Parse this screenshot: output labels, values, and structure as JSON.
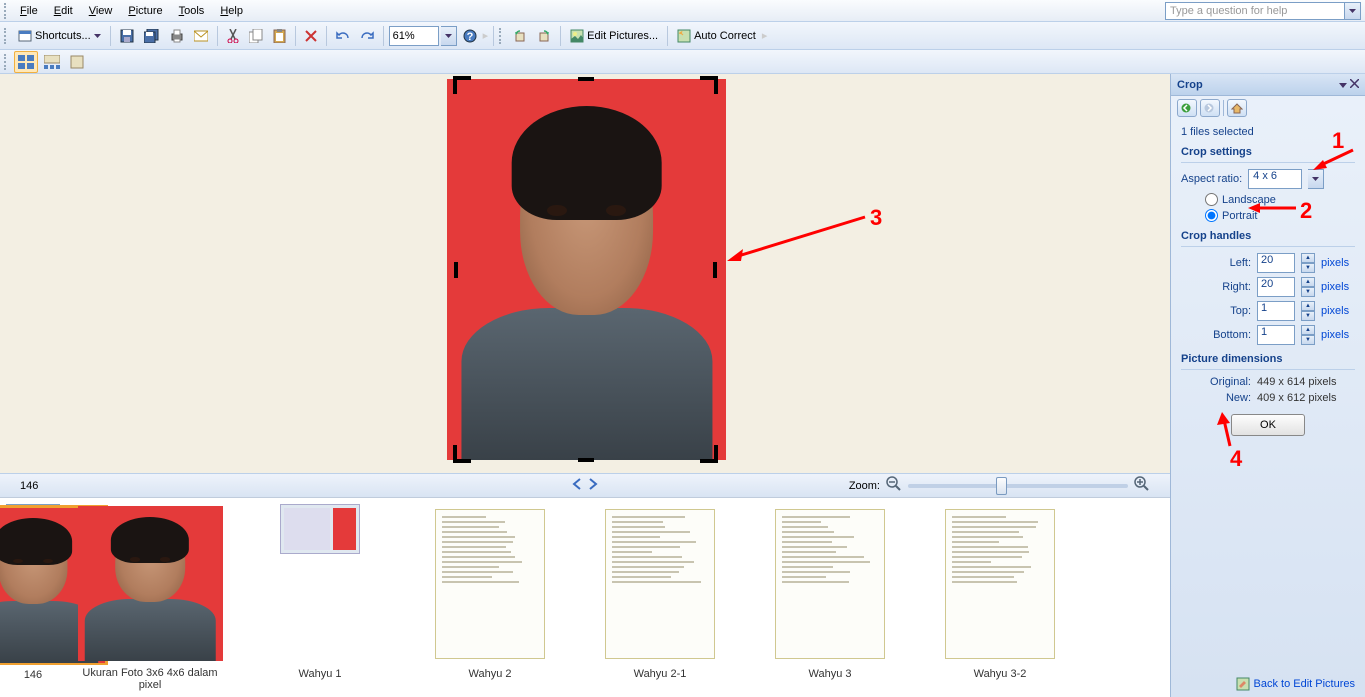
{
  "menu": {
    "items": [
      "File",
      "Edit",
      "View",
      "Picture",
      "Tools",
      "Help"
    ],
    "help_placeholder": "Type a question for help"
  },
  "toolbar": {
    "shortcuts": "Shortcuts...",
    "zoom": "61%",
    "edit_pictures": "Edit Pictures...",
    "auto_correct": "Auto Correct"
  },
  "status": {
    "filename": "146",
    "zoom_label": "Zoom:"
  },
  "thumbs": [
    {
      "label": "146",
      "type": "portrait",
      "sel": true
    },
    {
      "label": "Ukuran Foto 3x6 4x6 dalam pixel",
      "type": "portrait"
    },
    {
      "label": "Wahyu 1",
      "type": "id"
    },
    {
      "label": "Wahyu 2",
      "type": "doc"
    },
    {
      "label": "Wahyu 2-1",
      "type": "doc"
    },
    {
      "label": "Wahyu 3",
      "type": "doc"
    },
    {
      "label": "Wahyu 3-2",
      "type": "doc"
    }
  ],
  "panel": {
    "title": "Crop",
    "files_selected": "1 files selected",
    "crop_settings": "Crop settings",
    "aspect_ratio_label": "Aspect ratio:",
    "aspect_ratio_value": "4 x 6",
    "landscape": "Landscape",
    "portrait": "Portrait",
    "orientation_selected": "portrait",
    "crop_handles": "Crop handles",
    "left_label": "Left:",
    "left_value": "20",
    "right_label": "Right:",
    "right_value": "20",
    "top_label": "Top:",
    "top_value": "1",
    "bottom_label": "Bottom:",
    "bottom_value": "1",
    "unit": "pixels",
    "pic_dims": "Picture dimensions",
    "original_label": "Original:",
    "original_value": "449 x 614 pixels",
    "new_label": "New:",
    "new_value": "409 x 612 pixels",
    "ok": "OK",
    "back_link": "Back to Edit Pictures"
  },
  "annotations": {
    "a1": "1",
    "a2": "2",
    "a3": "3",
    "a4": "4"
  }
}
